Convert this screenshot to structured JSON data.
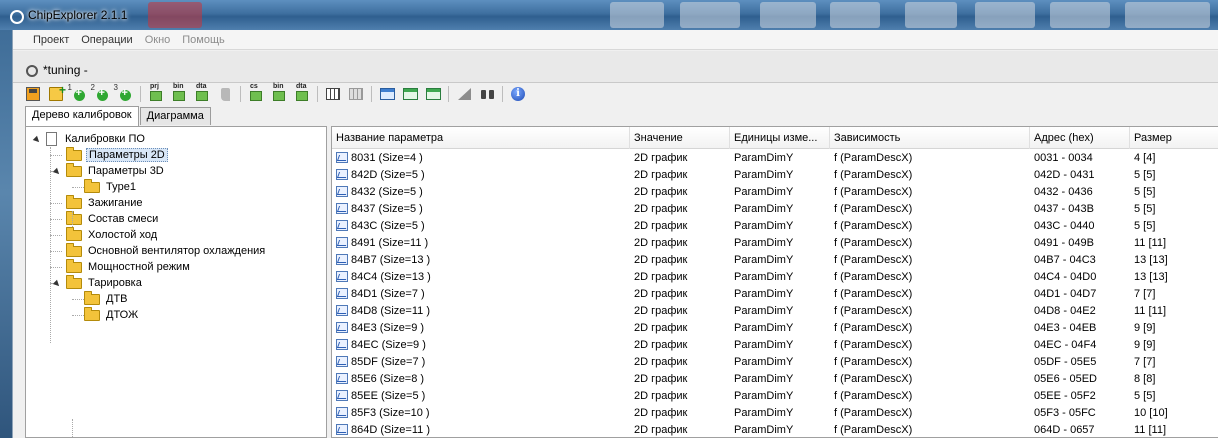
{
  "window": {
    "title": "ChipExplorer 2.1.1"
  },
  "menu": [
    {
      "label": "Проект",
      "style": "strong"
    },
    {
      "label": "Операции",
      "style": "strong"
    },
    {
      "label": "Окно",
      "style": "dim"
    },
    {
      "label": "Помощь",
      "style": "dim"
    }
  ],
  "document": {
    "title": "*tuning -"
  },
  "toolbar": [
    {
      "icon": "save-disk-icon",
      "cls": "disk",
      "tag": ""
    },
    {
      "icon": "add-folder-icon",
      "cls": "folder-add",
      "tag": ""
    },
    {
      "icon": "add-1d-icon",
      "cls": "num-add",
      "tag": "1"
    },
    {
      "icon": "add-2d-icon",
      "cls": "num-add",
      "tag": "2"
    },
    {
      "icon": "add-3d-icon",
      "cls": "num-add",
      "tag": "3"
    },
    {
      "sep": true
    },
    {
      "icon": "import-prj-icon",
      "cls": "file-tag",
      "tag": "prj"
    },
    {
      "icon": "import-bin-icon",
      "cls": "file-tag",
      "tag": "bin"
    },
    {
      "icon": "import-dta-icon",
      "cls": "file-tag",
      "tag": "dta"
    },
    {
      "icon": "boot-icon",
      "cls": "boot",
      "tag": ""
    },
    {
      "sep": true
    },
    {
      "icon": "checksum-icon",
      "cls": "file-tag",
      "tag": "cs"
    },
    {
      "icon": "export-bin-icon",
      "cls": "file-tag",
      "tag": "bin"
    },
    {
      "icon": "export-dta-icon",
      "cls": "file-tag",
      "tag": "dta"
    },
    {
      "sep": true
    },
    {
      "icon": "columns-icon",
      "cls": "columns",
      "tag": ""
    },
    {
      "icon": "columns-disabled-icon",
      "cls": "columns-x",
      "tag": ""
    },
    {
      "sep": true
    },
    {
      "icon": "window-blue-icon",
      "cls": "window-blue",
      "tag": ""
    },
    {
      "icon": "window-green-icon",
      "cls": "window-green",
      "tag": ""
    },
    {
      "icon": "window-green-alt-icon",
      "cls": "window-green",
      "tag": ""
    },
    {
      "sep": true
    },
    {
      "icon": "triangle-icon",
      "cls": "triangle",
      "tag": ""
    },
    {
      "icon": "binoculars-icon",
      "cls": "binoc",
      "tag": ""
    },
    {
      "sep": true
    },
    {
      "icon": "info-icon",
      "cls": "info",
      "tag": "i"
    }
  ],
  "tabs": [
    {
      "label": "Дерево калибровок",
      "active": true
    },
    {
      "label": "Диаграмма",
      "active": false
    }
  ],
  "tree": [
    {
      "label": "Калибровки ПО",
      "level": 0,
      "icon": "doc",
      "expand": true
    },
    {
      "label": "Параметры 2D",
      "level": 1,
      "icon": "folder",
      "selected": true
    },
    {
      "label": "Параметры 3D",
      "level": 1,
      "icon": "folder",
      "expand": true
    },
    {
      "label": "Type1",
      "level": 2,
      "icon": "folder"
    },
    {
      "label": "Зажигание",
      "level": 1,
      "icon": "folder"
    },
    {
      "label": "Состав смеси",
      "level": 1,
      "icon": "folder"
    },
    {
      "label": "Холостой ход",
      "level": 1,
      "icon": "folder"
    },
    {
      "label": "Основной вентилятор охлаждения",
      "level": 1,
      "icon": "folder"
    },
    {
      "label": "Мощностной режим",
      "level": 1,
      "icon": "folder"
    },
    {
      "label": "Тарировка",
      "level": 1,
      "icon": "folder",
      "expand": true
    },
    {
      "label": "ДТВ",
      "level": 2,
      "icon": "folder"
    },
    {
      "label": "ДТОЖ",
      "level": 2,
      "icon": "folder"
    }
  ],
  "grid": {
    "columns": [
      "Название параметра",
      "Значение",
      "Единицы изме...",
      "Зависимость",
      "Адрес (hex)",
      "Размер"
    ],
    "rows": [
      [
        "8031 (Size=4 )",
        "2D график",
        "ParamDimY",
        "f (ParamDescX)",
        "0031 - 0034",
        "4 [4]"
      ],
      [
        "842D (Size=5 )",
        "2D график",
        "ParamDimY",
        "f (ParamDescX)",
        "042D - 0431",
        "5 [5]"
      ],
      [
        "8432 (Size=5 )",
        "2D график",
        "ParamDimY",
        "f (ParamDescX)",
        "0432 - 0436",
        "5 [5]"
      ],
      [
        "8437 (Size=5 )",
        "2D график",
        "ParamDimY",
        "f (ParamDescX)",
        "0437 - 043B",
        "5 [5]"
      ],
      [
        "843C (Size=5 )",
        "2D график",
        "ParamDimY",
        "f (ParamDescX)",
        "043C - 0440",
        "5 [5]"
      ],
      [
        "8491 (Size=11 )",
        "2D график",
        "ParamDimY",
        "f (ParamDescX)",
        "0491 - 049B",
        "11 [11]"
      ],
      [
        "84B7 (Size=13 )",
        "2D график",
        "ParamDimY",
        "f (ParamDescX)",
        "04B7 - 04C3",
        "13 [13]"
      ],
      [
        "84C4 (Size=13 )",
        "2D график",
        "ParamDimY",
        "f (ParamDescX)",
        "04C4 - 04D0",
        "13 [13]"
      ],
      [
        "84D1 (Size=7 )",
        "2D график",
        "ParamDimY",
        "f (ParamDescX)",
        "04D1 - 04D7",
        "7 [7]"
      ],
      [
        "84D8 (Size=11 )",
        "2D график",
        "ParamDimY",
        "f (ParamDescX)",
        "04D8 - 04E2",
        "11 [11]"
      ],
      [
        "84E3 (Size=9 )",
        "2D график",
        "ParamDimY",
        "f (ParamDescX)",
        "04E3 - 04EB",
        "9 [9]"
      ],
      [
        "84EC (Size=9 )",
        "2D график",
        "ParamDimY",
        "f (ParamDescX)",
        "04EC - 04F4",
        "9 [9]"
      ],
      [
        "85DF (Size=7 )",
        "2D график",
        "ParamDimY",
        "f (ParamDescX)",
        "05DF - 05E5",
        "7 [7]"
      ],
      [
        "85E6 (Size=8 )",
        "2D график",
        "ParamDimY",
        "f (ParamDescX)",
        "05E6 - 05ED",
        "8 [8]"
      ],
      [
        "85EE (Size=5 )",
        "2D график",
        "ParamDimY",
        "f (ParamDescX)",
        "05EE - 05F2",
        "5 [5]"
      ],
      [
        "85F3 (Size=10 )",
        "2D график",
        "ParamDimY",
        "f (ParamDescX)",
        "05F3 - 05FC",
        "10 [10]"
      ],
      [
        "864D (Size=11 )",
        "2D график",
        "ParamDimY",
        "f (ParamDescX)",
        "064D - 0657",
        "11 [11]"
      ]
    ]
  }
}
